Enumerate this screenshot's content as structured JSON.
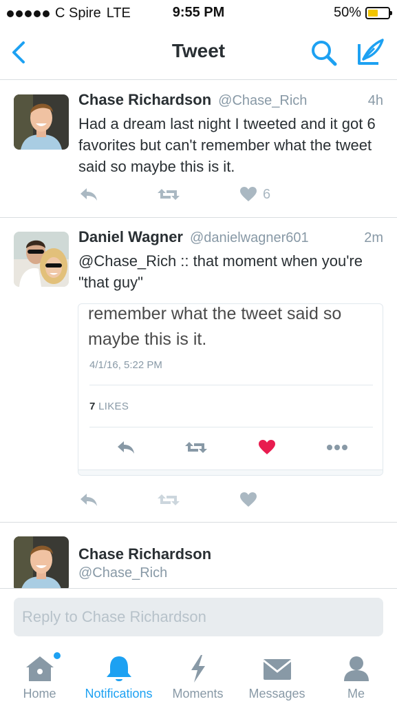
{
  "status_bar": {
    "carrier": "C Spire",
    "network": "LTE",
    "time": "9:55 PM",
    "battery": "50%",
    "battery_level": 0.5,
    "signal_bars": 5
  },
  "nav": {
    "title": "Tweet",
    "accent_color": "#1da1f2"
  },
  "tweets": [
    {
      "name": "Chase Richardson",
      "handle": "@Chase_Rich",
      "time": "4h",
      "text": "Had a dream last night I tweeted and it got 6 favorites but can't remember what the tweet said so maybe this is it.",
      "likes": "6"
    },
    {
      "name": "Daniel Wagner",
      "handle": "@danielwagner601",
      "time": "2m",
      "text": "@Chase_Rich :: that moment when you're \"that guy\"",
      "embed": {
        "text": "remember what the tweet said so maybe this is it.",
        "date": "4/1/16, 5:22 PM",
        "likes_count": "7",
        "likes_label": "LIKES"
      }
    },
    {
      "name": "Chase Richardson",
      "handle": "@Chase_Rich"
    }
  ],
  "reply": {
    "placeholder": "Reply to Chase Richardson"
  },
  "tabs": [
    {
      "label": "Home",
      "icon": "home-icon"
    },
    {
      "label": "Notifications",
      "icon": "bell-icon",
      "active": true
    },
    {
      "label": "Moments",
      "icon": "lightning-icon"
    },
    {
      "label": "Messages",
      "icon": "envelope-icon"
    },
    {
      "label": "Me",
      "icon": "person-icon"
    }
  ]
}
